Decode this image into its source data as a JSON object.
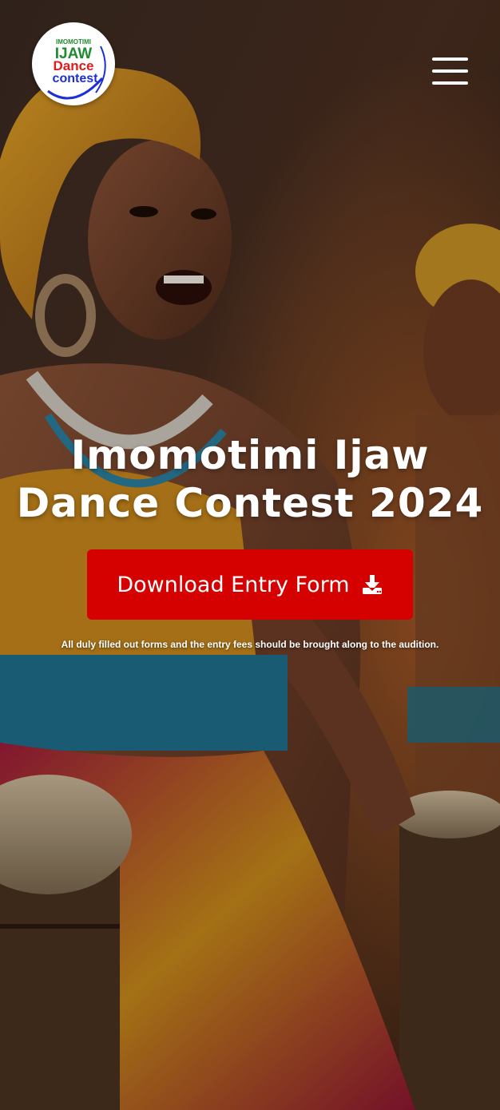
{
  "header": {
    "logo": {
      "line1": "IMOMOTIMI",
      "line2": "IJAW",
      "line3": "Dance",
      "line4": "contest"
    },
    "menu_icon": "hamburger-menu-icon"
  },
  "hero": {
    "background": "photo of smiling dancer in yellow head wrap with drums",
    "title_line1": "Imomotimi Ijaw",
    "title_line2": "Dance Contest 2024",
    "cta_label": "Download Entry Form",
    "cta_icon": "download-icon",
    "note": "All duly filled out forms and the entry fees should be brought along to the audition."
  },
  "colors": {
    "cta": "#d50000",
    "logo_green": "#1f8a2e",
    "logo_red": "#e01b1b",
    "logo_blue": "#1c2fd6"
  }
}
